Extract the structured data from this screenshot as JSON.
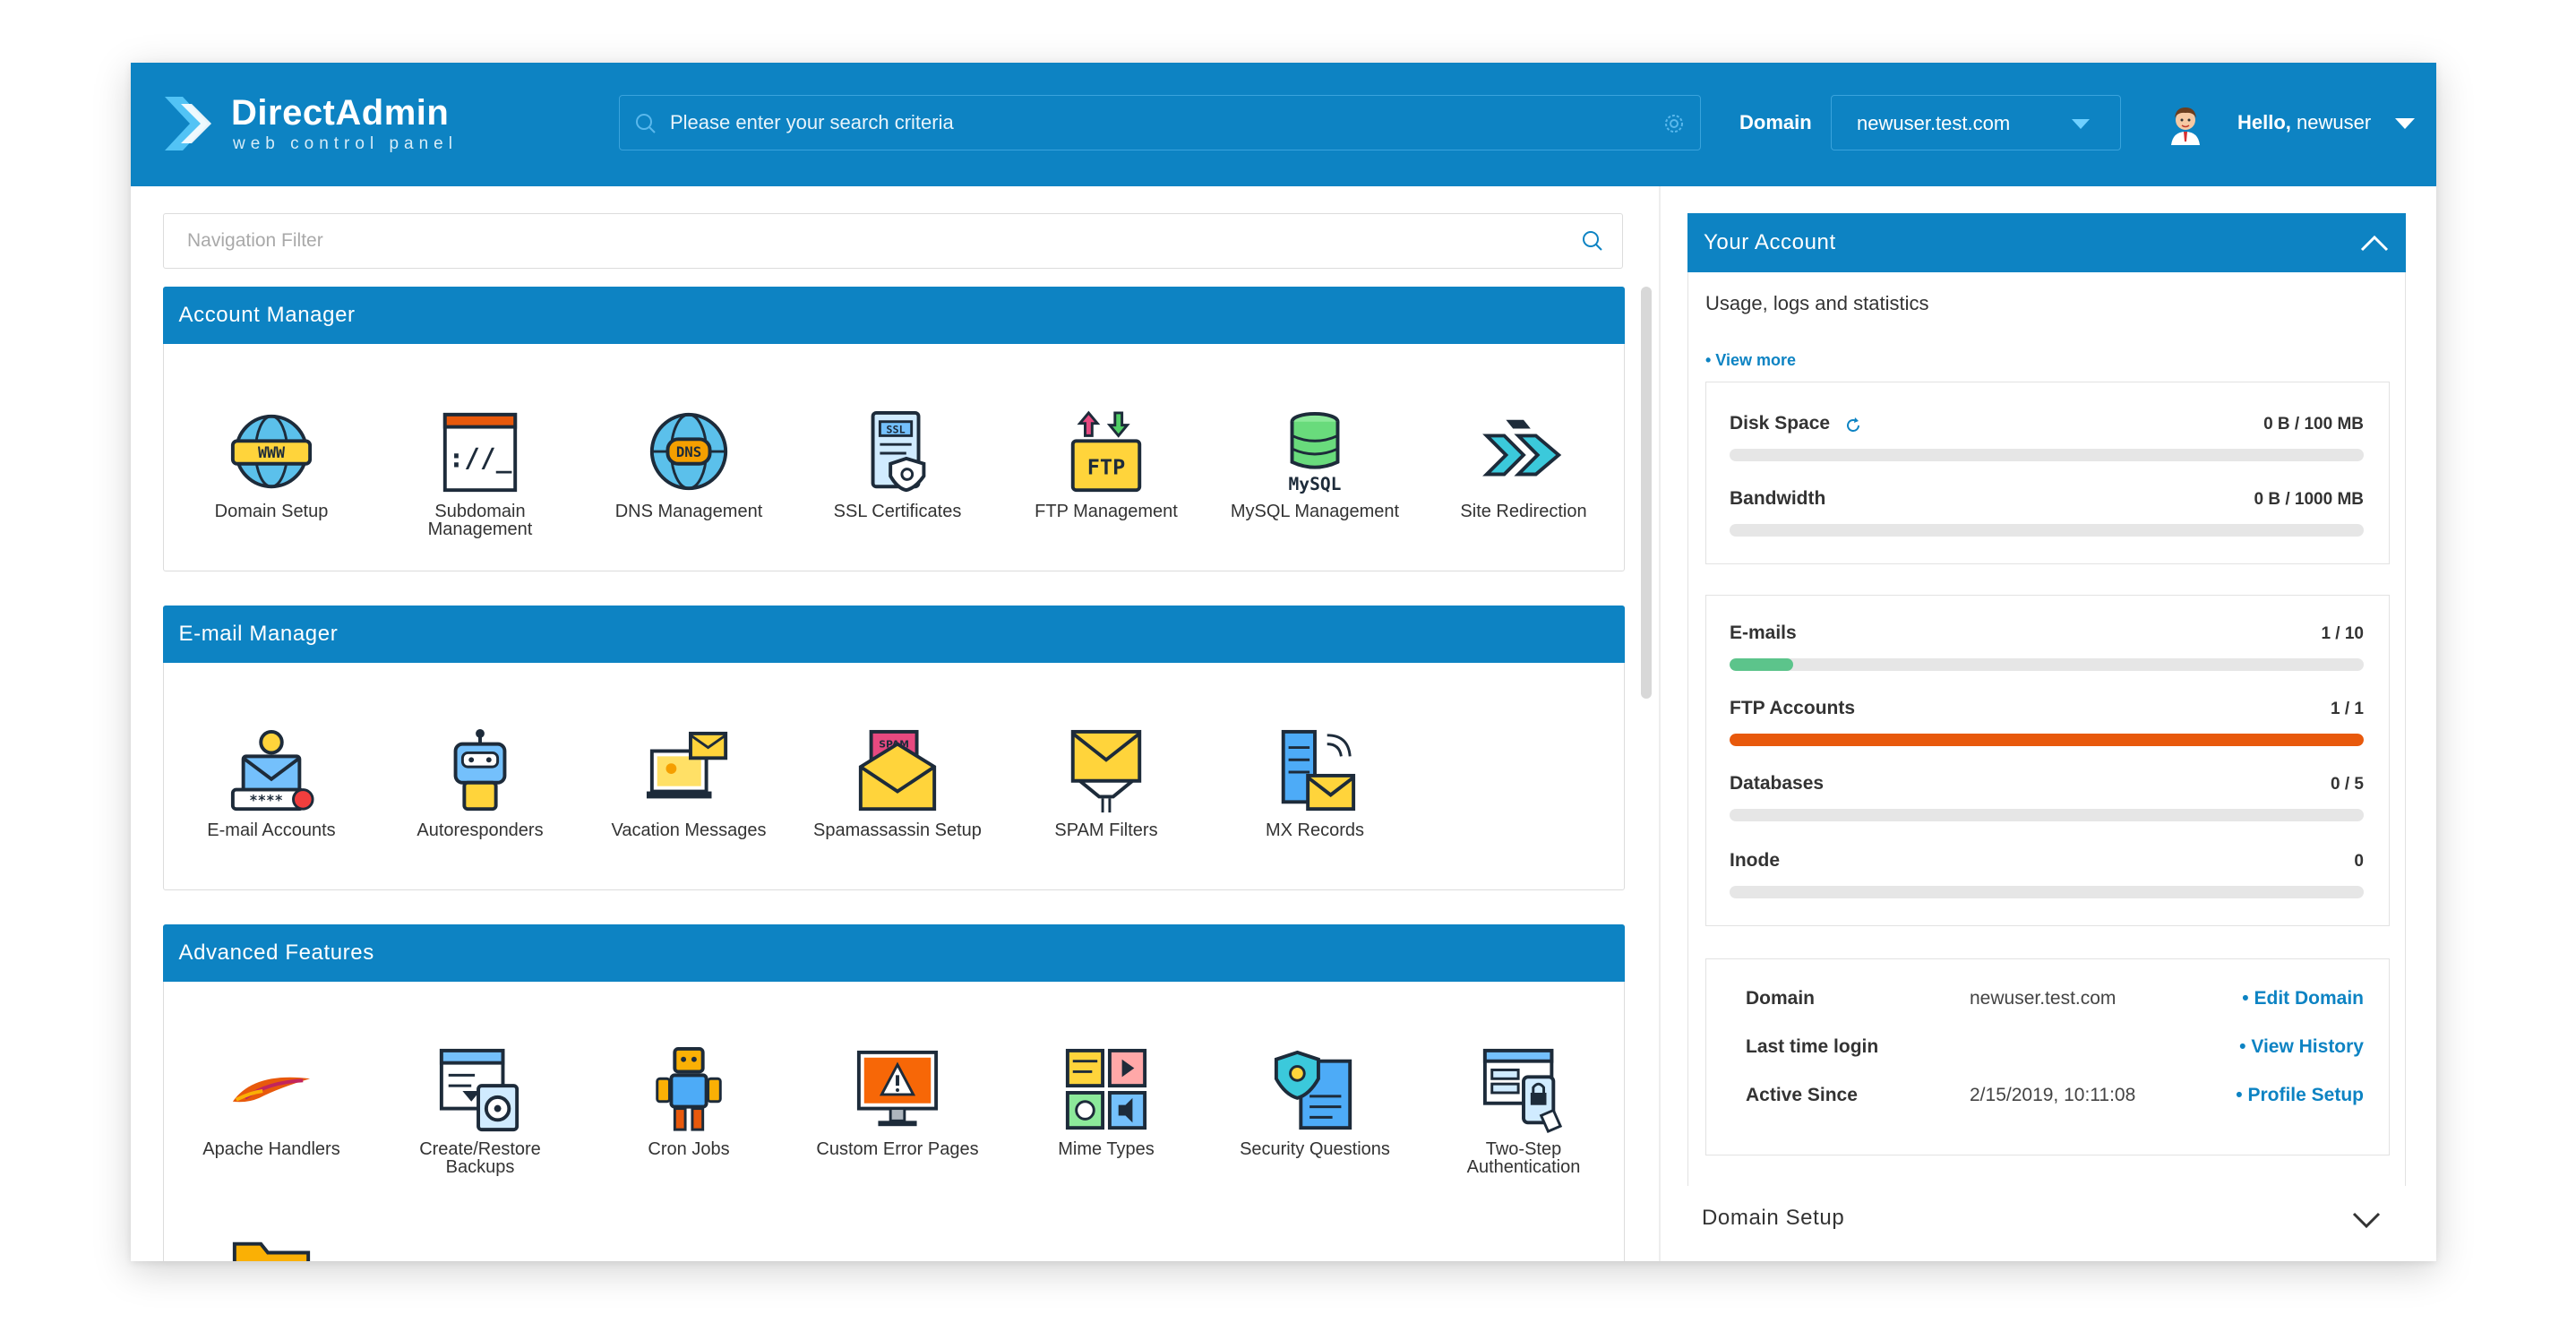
{
  "brand": {
    "title": "DirectAdmin",
    "subtitle": "web control panel"
  },
  "search": {
    "placeholder": "Please enter your search criteria"
  },
  "domain_selector": {
    "label": "Domain",
    "value": "newuser.test.com"
  },
  "user": {
    "greeting": "Hello,",
    "name": "newuser"
  },
  "nav_filter": {
    "placeholder": "Navigation Filter"
  },
  "sections": [
    {
      "title": "Account Manager",
      "items": [
        {
          "label": "Domain Setup",
          "icon": "www-globe-icon"
        },
        {
          "label": "Subdomain Management",
          "icon": "terminal-window-icon"
        },
        {
          "label": "DNS Management",
          "icon": "dns-globe-icon"
        },
        {
          "label": "SSL Certificates",
          "icon": "ssl-certificate-icon"
        },
        {
          "label": "FTP Management",
          "icon": "ftp-folder-icon"
        },
        {
          "label": "MySQL Management",
          "icon": "mysql-database-icon"
        },
        {
          "label": "Site Redirection",
          "icon": "redirect-arrows-icon"
        }
      ]
    },
    {
      "title": "E-mail Manager",
      "items": [
        {
          "label": "E-mail Accounts",
          "icon": "email-account-icon"
        },
        {
          "label": "Autoresponders",
          "icon": "robot-icon"
        },
        {
          "label": "Vacation Messages",
          "icon": "vacation-laptop-icon"
        },
        {
          "label": "Spamassassin Setup",
          "icon": "spam-envelope-icon",
          "badge": "SPAM"
        },
        {
          "label": "SPAM Filters",
          "icon": "spam-filter-icon"
        },
        {
          "label": "MX Records",
          "icon": "mx-server-icon"
        }
      ]
    },
    {
      "title": "Advanced Features",
      "items": [
        {
          "label": "Apache Handlers",
          "icon": "apache-feather-icon"
        },
        {
          "label": "Create/Restore Backups",
          "icon": "backup-icon"
        },
        {
          "label": "Cron Jobs",
          "icon": "cron-robot-icon"
        },
        {
          "label": "Custom Error Pages",
          "icon": "error-monitor-icon"
        },
        {
          "label": "Mime Types",
          "icon": "mime-types-icon"
        },
        {
          "label": "Security Questions",
          "icon": "security-shield-icon"
        },
        {
          "label": "Two-Step Authentication",
          "icon": "two-step-auth-icon"
        },
        {
          "label": "",
          "icon": "password-folder-icon"
        }
      ]
    }
  ],
  "account_panel": {
    "title": "Your Account",
    "description": "Usage, logs and statistics",
    "view_more": "• View more",
    "usage": [
      {
        "name": "Disk Space",
        "value": "0 B / 100 MB",
        "fraction": 0,
        "color": "#e6e6e6"
      },
      {
        "name": "Bandwidth",
        "value": "0 B / 1000 MB",
        "fraction": 0,
        "color": "#e6e6e6"
      }
    ],
    "limits": [
      {
        "name": "E-mails",
        "value": "1 / 10",
        "fraction": 0.1,
        "color": "#5cc48b"
      },
      {
        "name": "FTP Accounts",
        "value": "1 / 1",
        "fraction": 1.0,
        "color": "#e8590c"
      },
      {
        "name": "Databases",
        "value": "0 / 5",
        "fraction": 0,
        "color": "#e6e6e6"
      },
      {
        "name": "Inode",
        "value": "0",
        "fraction": 0,
        "color": "#e6e6e6"
      }
    ],
    "info": [
      {
        "key": "Domain",
        "value": "newuser.test.com",
        "action": "• Edit Domain"
      },
      {
        "key": "Last time login",
        "value": "",
        "action": "• View History"
      },
      {
        "key": "Active Since",
        "value": "2/15/2019, 10:11:08",
        "action": "• Profile Setup"
      }
    ]
  },
  "domain_setup_panel": {
    "title": "Domain Setup"
  },
  "colors": {
    "primary": "#0d83c3",
    "email_bar": "#5cc48b",
    "ftp_bar": "#e8590c"
  }
}
